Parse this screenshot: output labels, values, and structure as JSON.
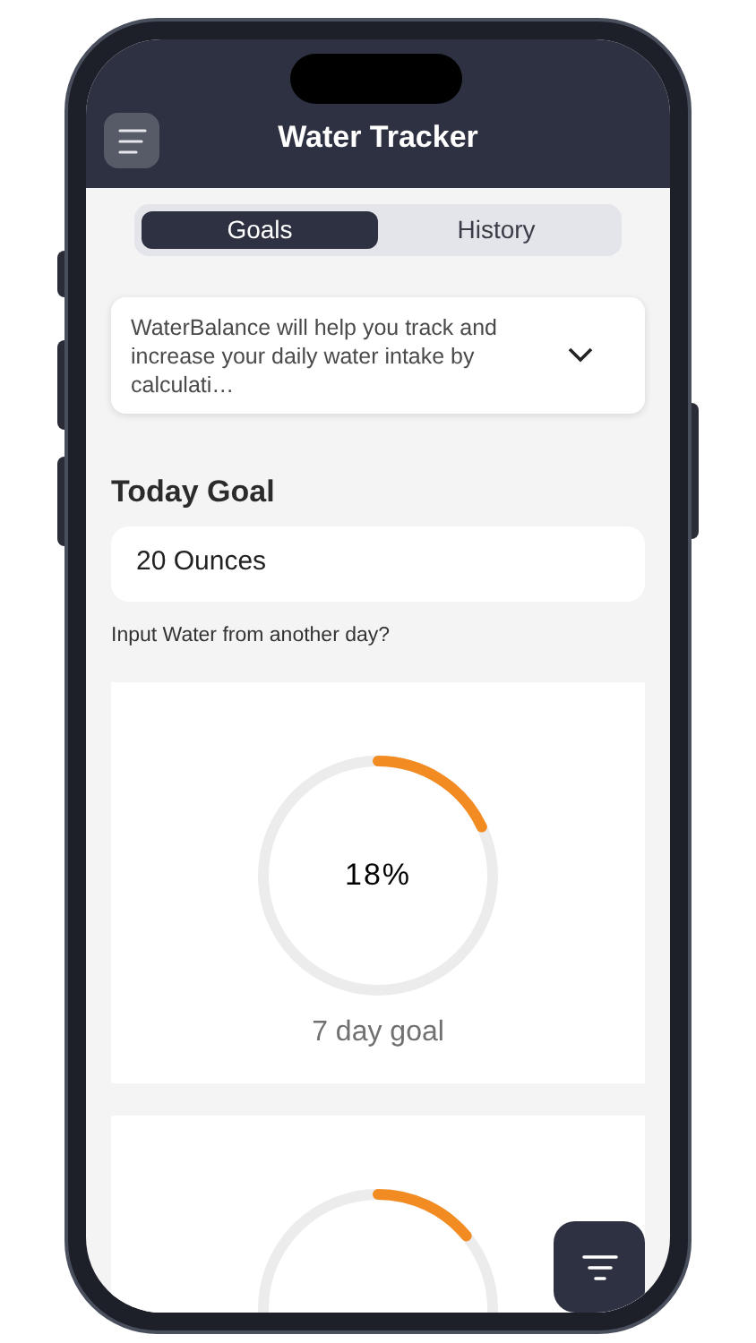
{
  "header": {
    "title": "Water Tracker"
  },
  "tabs": [
    {
      "label": "Goals",
      "selected": true
    },
    {
      "label": "History",
      "selected": false
    }
  ],
  "description": {
    "text": "WaterBalance will help you track and increase your daily water intake by calculati…",
    "expanded": false
  },
  "today_goal": {
    "label": "Today Goal",
    "value": "20 Ounces"
  },
  "other_day_link": "Input Water from another day?",
  "goal_cards": [
    {
      "percent": "18%",
      "level": 0.18,
      "caption": "7 day goal"
    },
    {
      "level": 0.14
    }
  ]
}
